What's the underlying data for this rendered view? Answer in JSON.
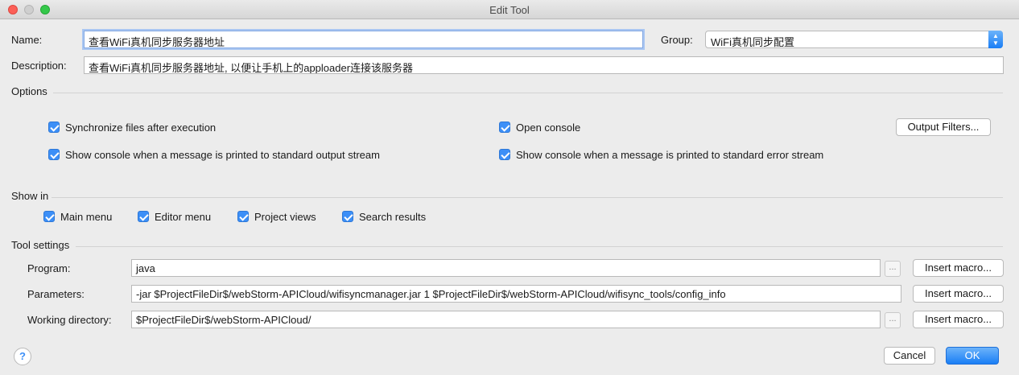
{
  "window": {
    "title": "Edit Tool"
  },
  "form": {
    "name_label": "Name:",
    "name_value": "查看WiFi真机同步服务器地址",
    "group_label": "Group:",
    "group_value": "WiFi真机同步配置",
    "description_label": "Description:",
    "description_value": "查看WiFi真机同步服务器地址, 以便让手机上的apploader连接该服务器"
  },
  "options": {
    "header": "Options",
    "sync_files": "Synchronize files after execution",
    "open_console": "Open console",
    "output_filters": "Output Filters...",
    "show_console_stdout": "Show console when a message is printed to standard output stream",
    "show_console_stderr": "Show console when a message is printed to standard error stream"
  },
  "show_in": {
    "header": "Show in",
    "main_menu": "Main menu",
    "editor_menu": "Editor menu",
    "project_views": "Project views",
    "search_results": "Search results"
  },
  "tool_settings": {
    "header": "Tool settings",
    "program_label": "Program:",
    "program_value": "java",
    "parameters_label": "Parameters:",
    "parameters_value": "-jar $ProjectFileDir$/webStorm-APICloud/wifisyncmanager.jar 1 $ProjectFileDir$/webStorm-APICloud/wifisync_tools/config_info",
    "working_dir_label": "Working directory:",
    "working_dir_value": "$ProjectFileDir$/webStorm-APICloud/",
    "insert_macro": "Insert macro...",
    "browse": "..."
  },
  "footer": {
    "help": "?",
    "cancel": "Cancel",
    "ok": "OK"
  },
  "colors": {
    "accent": "#3c8ff7",
    "close": "#fc5f57",
    "maximize": "#34c84a"
  }
}
